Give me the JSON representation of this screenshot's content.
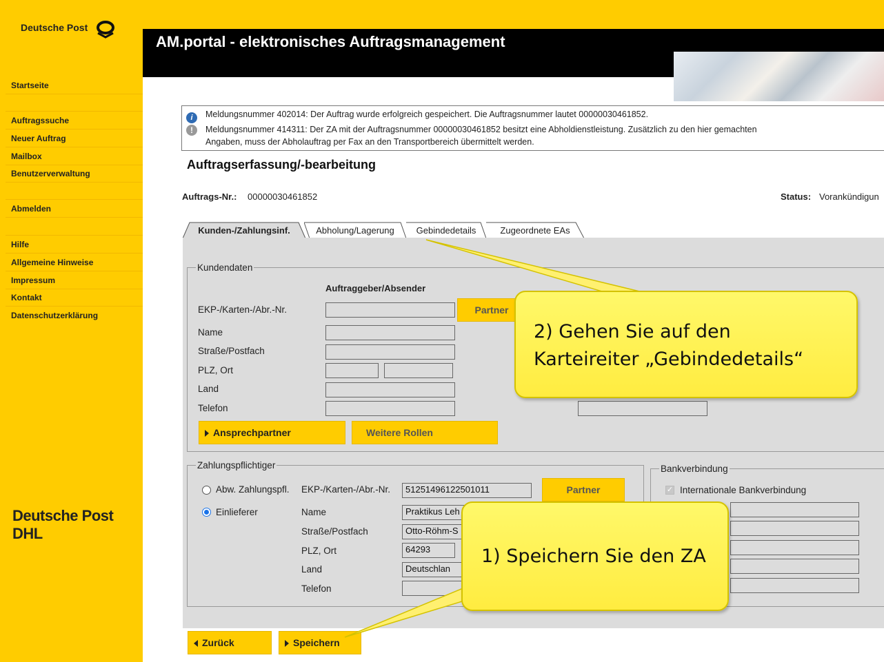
{
  "sidebar": {
    "logo_text": "Deutsche Post",
    "items": [
      "Startseite",
      "Auftragssuche",
      "Neuer Auftrag",
      "Mailbox",
      "Benutzerverwaltung",
      "Abmelden",
      "Hilfe",
      "Allgemeine Hinweise",
      "Impressum",
      "Kontakt",
      "Datenschutzerklärung"
    ],
    "footer_logo": "Deutsche Post DHL"
  },
  "header": {
    "title": "AM.portal - elektronisches Auftragsmanagement"
  },
  "messages": [
    "Meldungsnummer 402014: Der Auftrag wurde erfolgreich gespeichert. Die Auftragsnummer lautet 00000030461852.",
    "Meldungsnummer 414311: Der ZA mit der Auftragsnummer 00000030461852 besitzt eine Abholdienstleistung. Zusätzlich zu den hier gemachten",
    "Angaben, muss der Abholauftrag per Fax an den Transportbereich übermittelt werden."
  ],
  "page_title": "Auftragserfassung/-bearbeitung",
  "order": {
    "nr_label": "Auftrags-Nr.:",
    "nr_value": "00000030461852",
    "status_label": "Status:",
    "status_value": "Vorankündigun"
  },
  "tabs": [
    "Kunden-/Zahlungsinf.",
    "Abholung/Lagerung",
    "Gebindedetails",
    "Zugeordnete EAs"
  ],
  "kundendaten": {
    "legend": "Kundendaten",
    "column_header": "Auftraggeber/Absender",
    "labels": [
      "EKP-/Karten-/Abr.-Nr.",
      "Name",
      "Straße/Postfach",
      "PLZ, Ort",
      "Land",
      "Telefon"
    ],
    "partner_button": "Partner",
    "ansprechpartner_button": "Ansprechpartner",
    "weitere_rollen_button": "Weitere Rollen"
  },
  "zahlungspflichtiger": {
    "legend": "Zahlungspflichtiger",
    "radio_abw": "Abw. Zahlungspfl.",
    "radio_einlieferer": "Einlieferer",
    "ekp_label": "EKP-/Karten-/Abr.-Nr.",
    "ekp_value": "51251496122501011",
    "partner_button": "Partner",
    "labels": [
      "Name",
      "Straße/Postfach",
      "PLZ, Ort",
      "Land",
      "Telefon"
    ],
    "values": [
      "Praktikus Leh",
      "Otto-Röhm-S",
      "64293",
      "Deutschlan",
      ""
    ]
  },
  "bankverbindung": {
    "legend": "Bankverbindung",
    "checkbox_label": "Internationale Bankverbindung"
  },
  "buttons": {
    "back": "Zurück",
    "save": "Speichern"
  },
  "callouts": {
    "step2": [
      "2) Gehen Sie auf den",
      "Karteireiter „Gebindedetails“"
    ],
    "step1": "1) Speichern Sie den ZA"
  },
  "colors": {
    "brand_yellow": "#ffcc00",
    "header_black": "#000000",
    "callout_yellow": "#fff86a"
  }
}
